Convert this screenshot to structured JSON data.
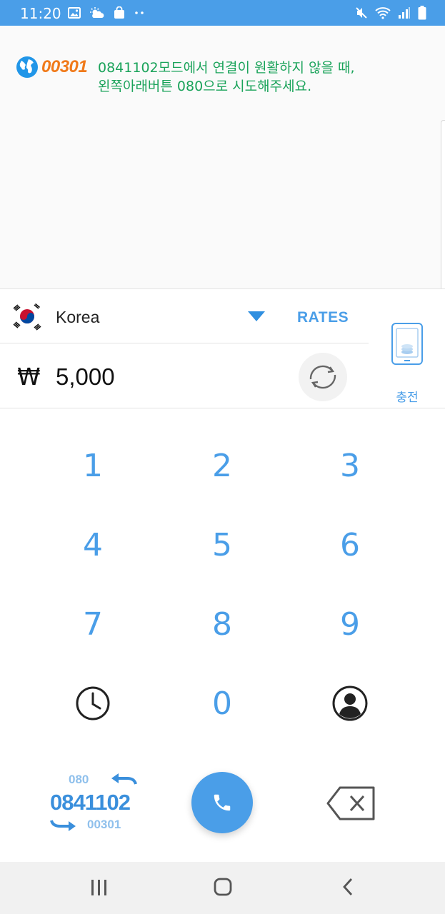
{
  "status_bar": {
    "time": "11:20",
    "icons_left": [
      "image-icon",
      "weather-icon",
      "shopping-bag-icon",
      "more-dots-icon"
    ],
    "icons_right": [
      "mute-icon",
      "wifi-icon",
      "signal-icon",
      "battery-icon"
    ]
  },
  "banner": {
    "brand": "00301",
    "notice_line1": "0841102모드에서 연결이 원활하지 않을 때,",
    "notice_line2": "왼쪽아래버튼 080으로 시도해주세요."
  },
  "country": {
    "name": "Korea",
    "rates_label": "RATES"
  },
  "balance": {
    "currency_symbol": "₩",
    "amount": "5,000"
  },
  "charge": {
    "label": "충전"
  },
  "keypad": {
    "keys": [
      "1",
      "2",
      "3",
      "4",
      "5",
      "6",
      "7",
      "8",
      "9",
      "0"
    ]
  },
  "mode_switch": {
    "top": "080",
    "main": "0841102",
    "bottom": "00301"
  },
  "colors": {
    "accent": "#4a9ee8",
    "notice_green": "#1aa35a",
    "brand_orange": "#f07a1a"
  }
}
